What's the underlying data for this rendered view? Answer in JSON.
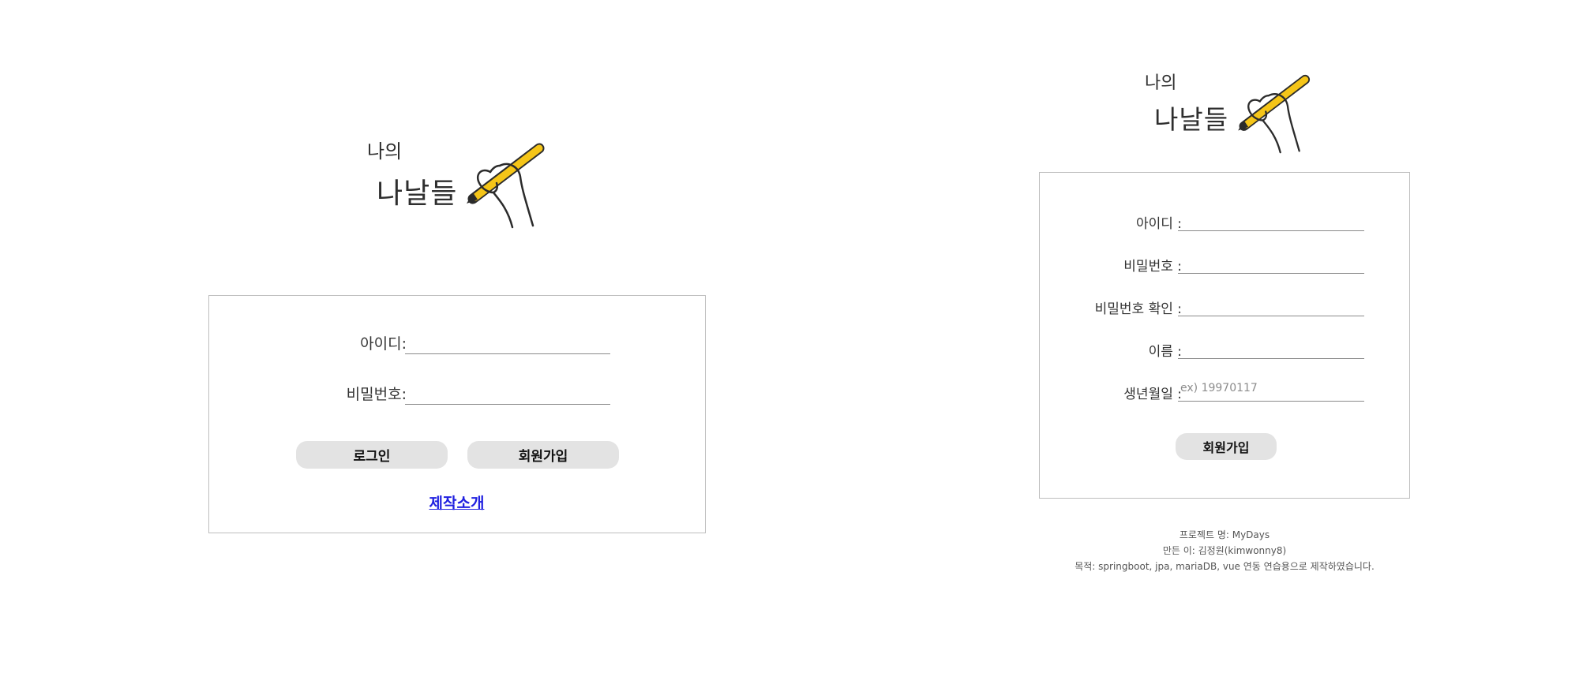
{
  "logo": {
    "line1": "나의",
    "line2": "나날들"
  },
  "login": {
    "id_label": "아이디:",
    "password_label": "비밀번호:",
    "login_button": "로그인",
    "signup_button": "회원가입",
    "about_link": "제작소개"
  },
  "signup": {
    "id_label": "아이디 :",
    "password_label": "비밀번호 :",
    "password_confirm_label": "비밀번호 확인 :",
    "name_label": "이름 :",
    "birth_label": "생년월일 :",
    "birth_placeholder": "ex) 19970117",
    "submit_button": "회원가입"
  },
  "footer": {
    "project": "프로젝트 명: MyDays",
    "author": "만든 이: 김정원(kimwonny8)",
    "purpose": "목적: springboot, jpa, mariaDB, vue 연동 연습용으로 제작하였습니다."
  },
  "colors": {
    "pencil": "#f5c518",
    "button_bg": "#e3e3e3",
    "border": "#bdbdbd",
    "link": "#2020e0"
  }
}
